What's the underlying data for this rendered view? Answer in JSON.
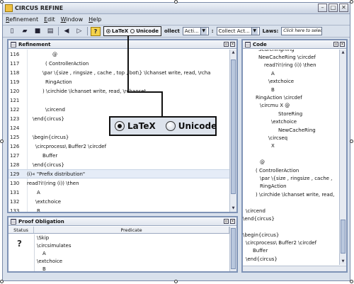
{
  "window": {
    "title": "CIRCUS REFINE"
  },
  "menu": [
    "Refinement",
    "Edit",
    "Window",
    "Help"
  ],
  "toolbar": {
    "radio_latex": "LaTeX",
    "radio_unicode": "Unicode",
    "collect_label": "ollect",
    "select_acti": "Acti...",
    "colon": ":",
    "select_collect": "Collect Act...",
    "laws_label": "Laws:",
    "laws_placeholder": "Click here to select"
  },
  "refinement_panel": {
    "title": "Refinement",
    "lines": [
      {
        "n": "116",
        "t": "@"
      },
      {
        "n": "117",
        "t": "(   ControllerAction"
      },
      {
        "n": "118",
        "t": "\\par \\{size , ringsize , cache , top , bot\\} \\lchanset write, read,  \\rcha"
      },
      {
        "n": "119",
        "t": "RingAction"
      },
      {
        "n": "120",
        "t": ") \\circhide \\lchanset write, read,  \\rchanset"
      },
      {
        "n": "121",
        "t": ""
      },
      {
        "n": "122",
        "t": "\\circend"
      },
      {
        "n": "123",
        "t": "\\end{circus}"
      },
      {
        "n": "124",
        "t": ""
      },
      {
        "n": "125",
        "t": "\\begin{circus}"
      },
      {
        "n": "126",
        "t": "\\circprocess\\  Buffer2 \\circdef"
      },
      {
        "n": "127",
        "t": "Buffer"
      },
      {
        "n": "128",
        "t": "\\end{circus}"
      },
      {
        "n": "129",
        "t": "(i)«     \"Prefix distribution\""
      },
      {
        "n": "130",
        "t": "read?i!(ring (i)) \\then"
      },
      {
        "n": "131",
        "t": "A"
      },
      {
        "n": "132",
        "t": "\\extchoice"
      },
      {
        "n": "133",
        "t": "B"
      }
    ]
  },
  "code_panel": {
    "title": "Code",
    "lines": [
      "SearchingRing",
      "NewCacheRing \\circdef",
      "read?i!(ring (i)) \\then",
      "A",
      "\\extchoice",
      "B",
      "RingAction \\circdef",
      "\\circmu X @",
      "StoreRing",
      "\\extchoice",
      "NewCacheRing",
      "\\circseq",
      "X",
      "",
      "@",
      "(   ControllerAction",
      "\\par \\{size , ringsize , cache ,",
      "RingAction",
      ") \\circhide \\lchanset write, read,",
      "",
      "\\circend",
      "\\end{circus}",
      "",
      "\\begin{circus}",
      "\\circprocess\\  Buffer2 \\circdef",
      "Buffer",
      "\\end{circus}"
    ]
  },
  "callout": {
    "latex": "LaTeX",
    "unicode": "Unicode"
  },
  "proof_panel": {
    "title": "Proof Obligation",
    "col_status": "Status",
    "col_predicate": "Predicate",
    "lines": [
      "\\Skip",
      "\\circsimulates",
      "A",
      "\\extchoice",
      "B"
    ],
    "status_icon": "question-icon"
  }
}
